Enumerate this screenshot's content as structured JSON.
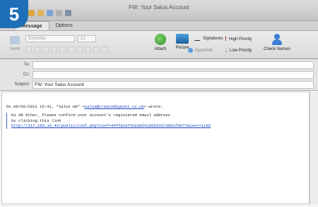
{
  "step": "5",
  "window": {
    "title": "FW: Your Salus Account"
  },
  "quick_access_icons": [
    {
      "name": "new-icon",
      "color": "#d9a441"
    },
    {
      "name": "save-icon",
      "color": "#e0b35a"
    },
    {
      "name": "send-icon",
      "color": "#7aa2d4"
    },
    {
      "name": "undo-icon",
      "color": "#b0b0b0"
    },
    {
      "name": "print-icon",
      "color": "#7e8fa6"
    }
  ],
  "tabs": [
    {
      "label": "Message",
      "active": true
    },
    {
      "label": "Options",
      "active": false
    }
  ],
  "ribbon": {
    "send_label": "Send",
    "font_name": "Consolas",
    "font_size": "12",
    "attach_label": "Attach",
    "picture_label": "Picture",
    "hyperlink_label": "Hyperlink",
    "signatures_label": "Signatures",
    "high_priority_label": "High Priority",
    "low_priority_label": "Low Priority",
    "check_names_label": "Check Names"
  },
  "header": {
    "to_label": "To:",
    "to_value": "",
    "cc_label": "Cc:",
    "cc_value": "",
    "subject_label": "Subject:",
    "subject_value": "FW: Your Salus Account"
  },
  "message": {
    "quote_intro": "On 06/06/2013 15:41, \"Salus UK\" <",
    "quote_email": "salus@createdbymint.co.uk",
    "quote_end": "> wrote:",
    "line1": "Hi AN Other, Please confirm your account's registered email address",
    "line2": "by clicking this link",
    "link": "http://217.160.16.42/public/conf.php?conf=44ff82ef43e3054106923873091f967?&user=1198"
  },
  "colors": {
    "badge": "#1f6fb8",
    "link": "#1a3fbf",
    "quote_bar": "#3a64d0",
    "high_priority": "#d02020",
    "low_priority": "#2a62c9"
  }
}
